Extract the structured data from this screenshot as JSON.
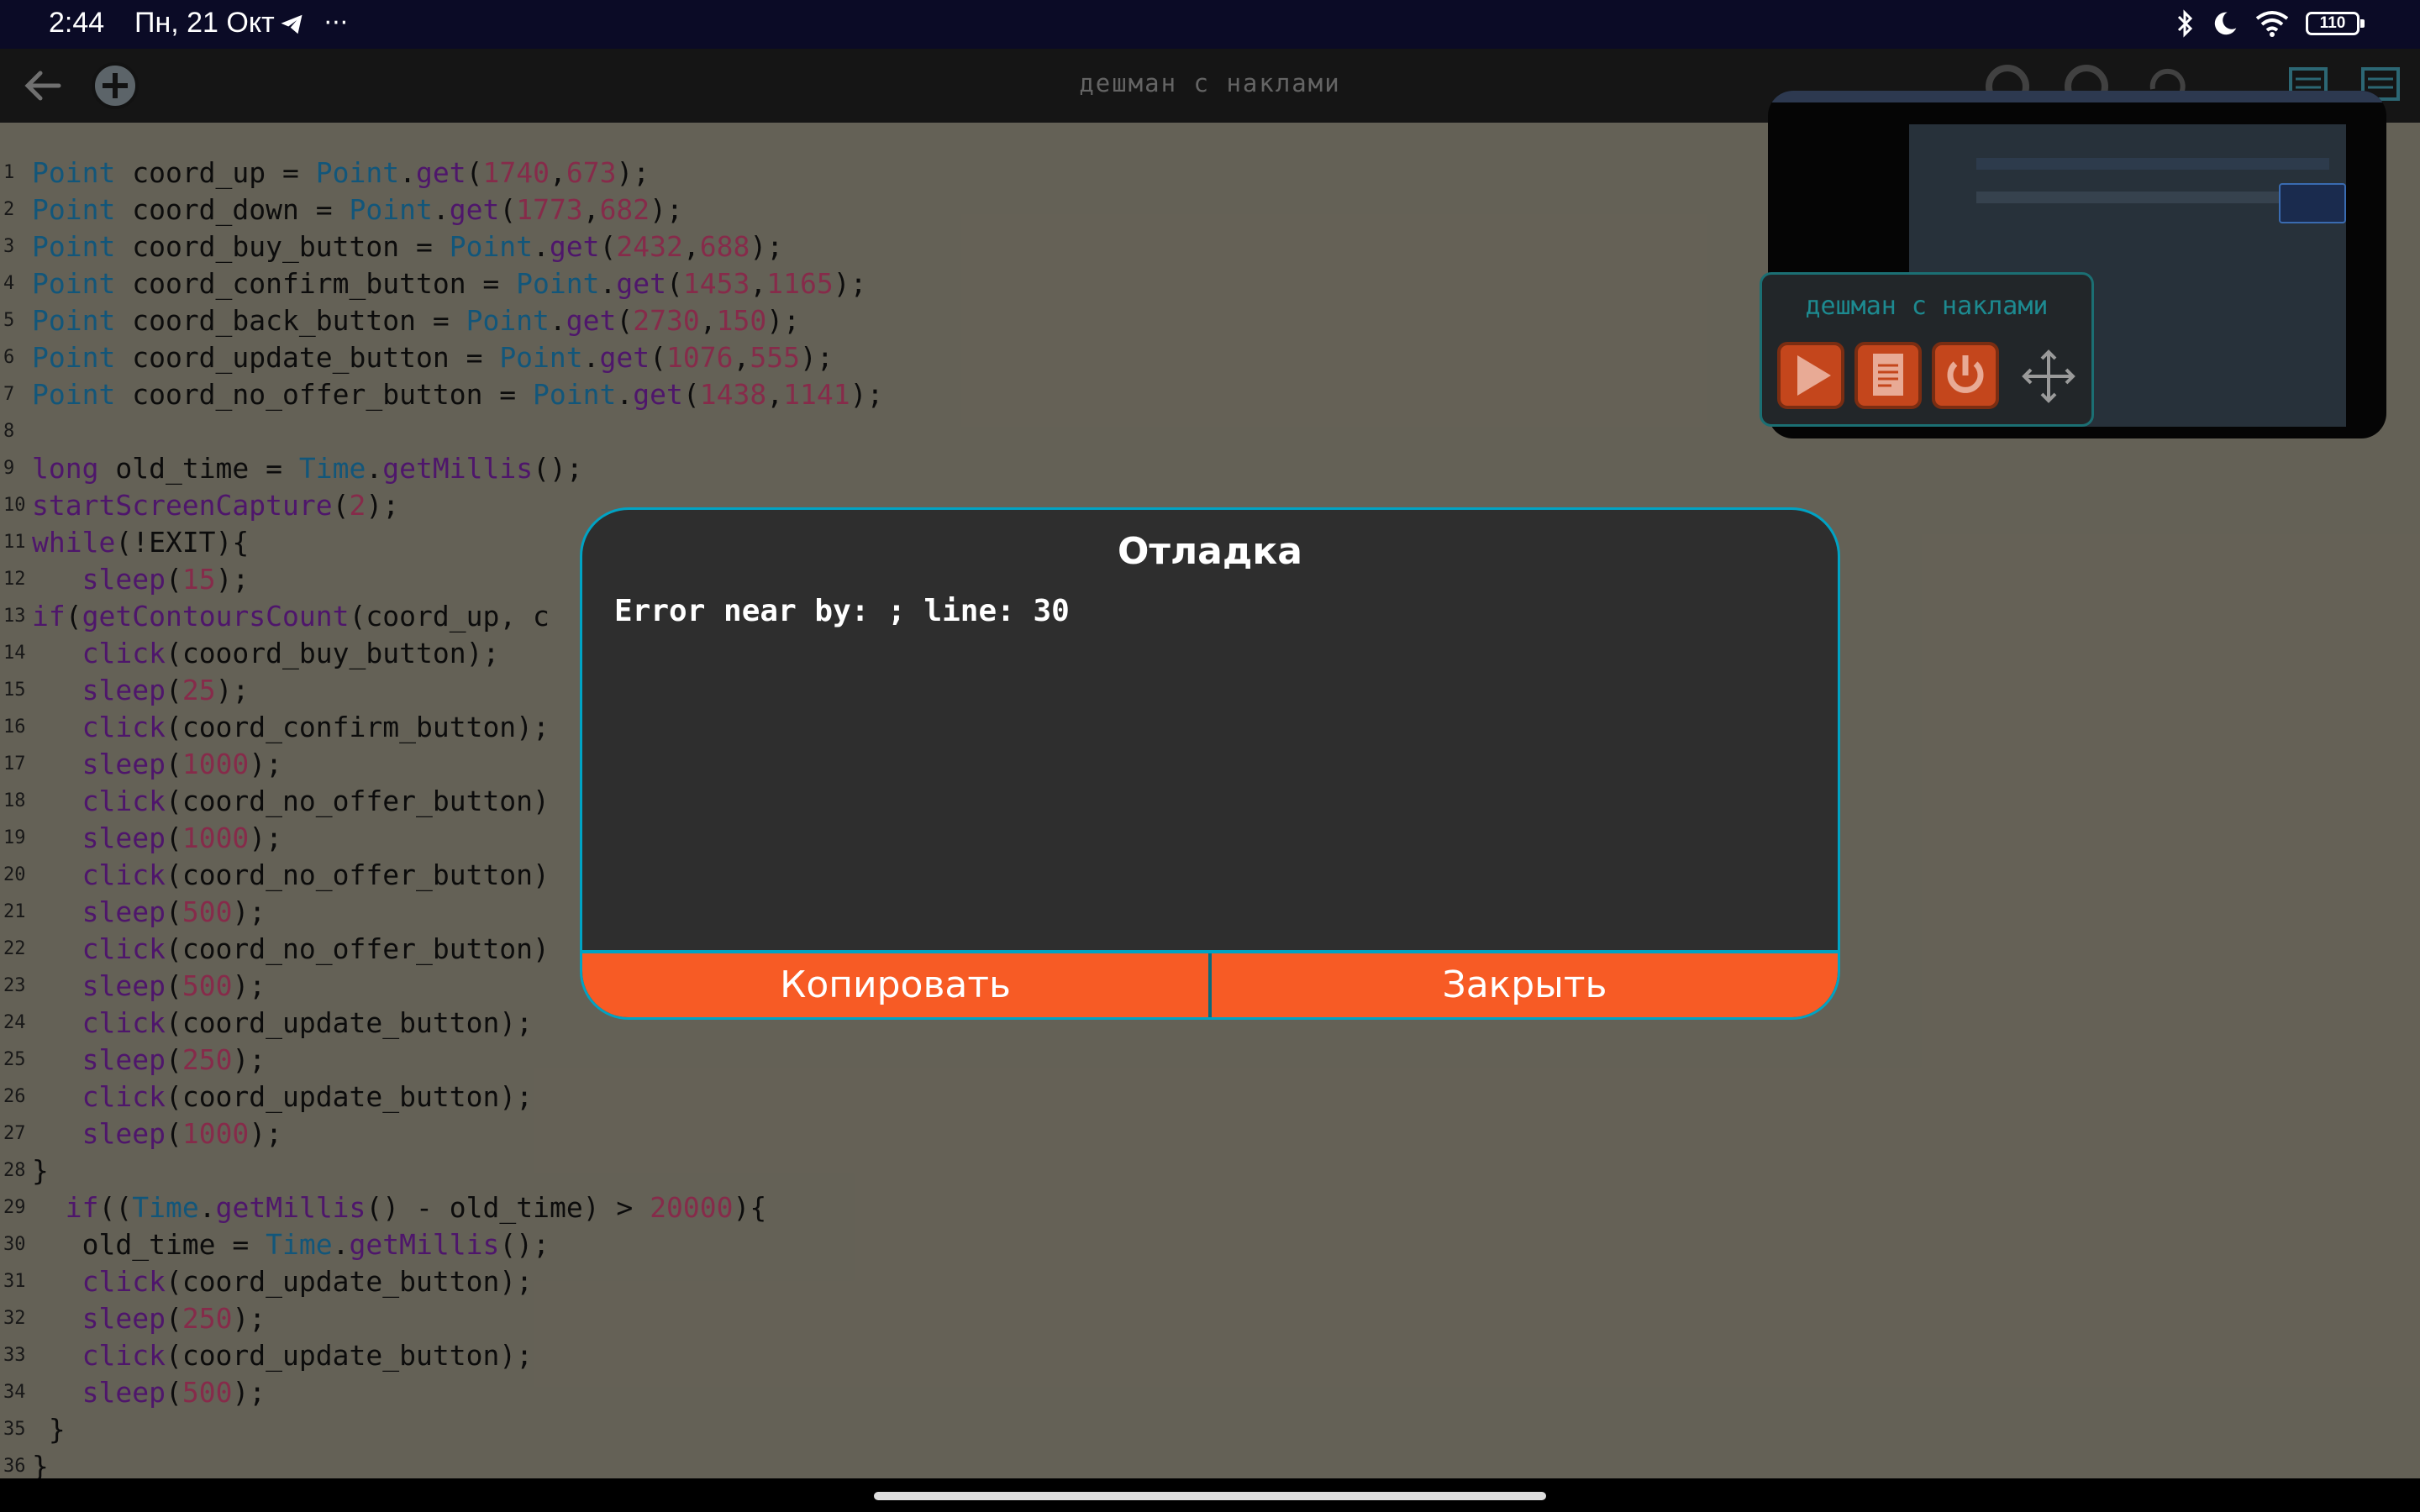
{
  "status_bar": {
    "time": "2:44",
    "date": "Пн, 21 Окт",
    "extra": "···",
    "battery": "110"
  },
  "toolbar": {
    "title": "дешман с наклами"
  },
  "editor": {
    "lines": [
      {
        "n": "1",
        "html": "<span class=\"kw\">Point</span> coord_up = <span class=\"kw\">Point</span>.<span class=\"pp\">get</span>(<span class=\"nm\">1740</span>,<span class=\"nm\">673</span>);"
      },
      {
        "n": "2",
        "html": "<span class=\"kw\">Point</span> coord_down = <span class=\"kw\">Point</span>.<span class=\"pp\">get</span>(<span class=\"nm\">1773</span>,<span class=\"nm\">682</span>);"
      },
      {
        "n": "3",
        "html": "<span class=\"kw\">Point</span> coord_buy_button = <span class=\"kw\">Point</span>.<span class=\"pp\">get</span>(<span class=\"nm\">2432</span>,<span class=\"nm\">688</span>);"
      },
      {
        "n": "4",
        "html": "<span class=\"kw\">Point</span> coord_confirm_button = <span class=\"kw\">Point</span>.<span class=\"pp\">get</span>(<span class=\"nm\">1453</span>,<span class=\"nm\">1165</span>);"
      },
      {
        "n": "5",
        "html": "<span class=\"kw\">Point</span> coord_back_button = <span class=\"kw\">Point</span>.<span class=\"pp\">get</span>(<span class=\"nm\">2730</span>,<span class=\"nm\">150</span>);"
      },
      {
        "n": "6",
        "html": "<span class=\"kw\">Point</span> coord_update_button = <span class=\"kw\">Point</span>.<span class=\"pp\">get</span>(<span class=\"nm\">1076</span>,<span class=\"nm\">555</span>);"
      },
      {
        "n": "7",
        "html": "<span class=\"kw\">Point</span> coord_no_offer_button = <span class=\"kw\">Point</span>.<span class=\"pp\">get</span>(<span class=\"nm\">1438</span>,<span class=\"nm\">1141</span>);"
      },
      {
        "n": "8",
        "html": ""
      },
      {
        "n": "9",
        "html": "<span class=\"pp\">long</span> old_time = <span class=\"kw\">Time</span>.<span class=\"pp\">getMillis</span>();"
      },
      {
        "n": "10",
        "html": "<span class=\"pp\">startScreenCapture</span>(<span class=\"nm\">2</span>);"
      },
      {
        "n": "11",
        "html": "<span class=\"pp\">while</span>(!EXIT){"
      },
      {
        "n": "12",
        "html": "   <span class=\"pp\">sleep</span>(<span class=\"nm\">15</span>);"
      },
      {
        "n": "13",
        "html": "<span class=\"pp\">if</span>(<span class=\"pp\">getContoursCount</span>(coord_up, c"
      },
      {
        "n": "14",
        "html": "   <span class=\"pp\">click</span>(cooord_buy_button);"
      },
      {
        "n": "15",
        "html": "   <span class=\"pp\">sleep</span>(<span class=\"nm\">25</span>);"
      },
      {
        "n": "16",
        "html": "   <span class=\"pp\">click</span>(coord_confirm_button);"
      },
      {
        "n": "17",
        "html": "   <span class=\"pp\">sleep</span>(<span class=\"nm\">1000</span>);"
      },
      {
        "n": "18",
        "html": "   <span class=\"pp\">click</span>(coord_no_offer_button)"
      },
      {
        "n": "19",
        "html": "   <span class=\"pp\">sleep</span>(<span class=\"nm\">1000</span>);"
      },
      {
        "n": "20",
        "html": "   <span class=\"pp\">click</span>(coord_no_offer_button)"
      },
      {
        "n": "21",
        "html": "   <span class=\"pp\">sleep</span>(<span class=\"nm\">500</span>);"
      },
      {
        "n": "22",
        "html": "   <span class=\"pp\">click</span>(coord_no_offer_button)"
      },
      {
        "n": "23",
        "html": "   <span class=\"pp\">sleep</span>(<span class=\"nm\">500</span>);"
      },
      {
        "n": "24",
        "html": "   <span class=\"pp\">click</span>(coord_update_button);"
      },
      {
        "n": "25",
        "html": "   <span class=\"pp\">sleep</span>(<span class=\"nm\">250</span>);"
      },
      {
        "n": "26",
        "html": "   <span class=\"pp\">click</span>(coord_update_button);"
      },
      {
        "n": "27",
        "html": "   <span class=\"pp\">sleep</span>(<span class=\"nm\">1000</span>);"
      },
      {
        "n": "28",
        "html": "}"
      },
      {
        "n": "29",
        "html": "  <span class=\"pp\">if</span>((<span class=\"kw\">Time</span>.<span class=\"pp\">getMillis</span>() - old_time) > <span class=\"nm\">20000</span>){"
      },
      {
        "n": "30",
        "html": "   old_time = <span class=\"kw\">Time</span>.<span class=\"pp\">getMillis</span>();"
      },
      {
        "n": "31",
        "html": "   <span class=\"pp\">click</span>(coord_update_button);"
      },
      {
        "n": "32",
        "html": "   <span class=\"pp\">sleep</span>(<span class=\"nm\">250</span>);"
      },
      {
        "n": "33",
        "html": "   <span class=\"pp\">click</span>(coord_update_button);"
      },
      {
        "n": "34",
        "html": "   <span class=\"pp\">sleep</span>(<span class=\"nm\">500</span>);"
      },
      {
        "n": "35",
        "html": " }"
      },
      {
        "n": "36",
        "html": "}"
      }
    ]
  },
  "floating_panel": {
    "title": "дешман с наклами"
  },
  "dialog": {
    "title": "Отладка",
    "message": "Error near by: ; line: 30",
    "copy_label": "Копировать",
    "close_label": "Закрыть"
  },
  "colors": {
    "accent": "#f75b25",
    "border": "#00a3c4",
    "editor_bg": "#8a8576"
  }
}
